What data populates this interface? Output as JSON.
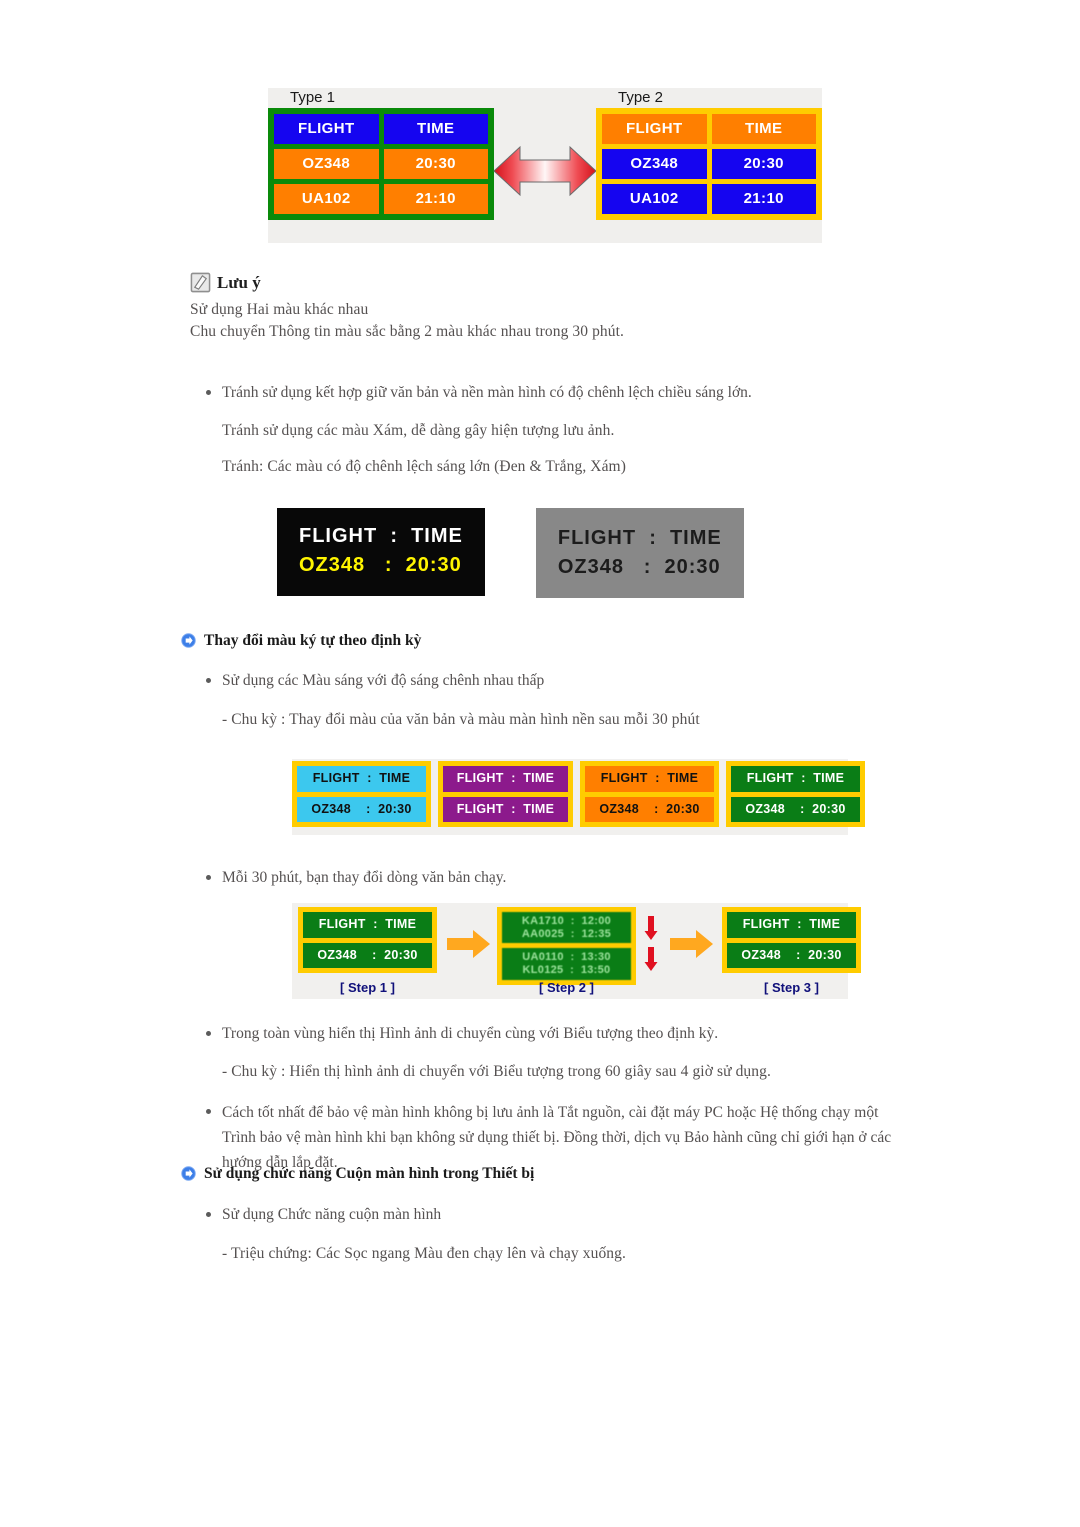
{
  "figure_types": {
    "name": "flight-board-color-swap",
    "columns": [
      {
        "label": "Type 1",
        "border_color": "#0a8a0a",
        "header_cell_color": "#1505f0",
        "data_cell_color": "#ff7f00",
        "rows": [
          [
            "FLIGHT",
            "TIME"
          ],
          [
            "OZ348",
            "20:30"
          ],
          [
            "UA102",
            "21:10"
          ]
        ]
      },
      {
        "label": "Type 2",
        "border_color": "#ffcc00",
        "header_cell_color": "#ff7f00",
        "data_cell_color": "#1505f0",
        "rows": [
          [
            "FLIGHT",
            "TIME"
          ],
          [
            "OZ348",
            "20:30"
          ],
          [
            "UA102",
            "21:10"
          ]
        ]
      }
    ],
    "arrow": "double-headed-horizontal-arrow",
    "arrow_color": "#e8232a"
  },
  "note": {
    "icon": "note-pencil-icon",
    "title": "Lưu ý",
    "lines": [
      "Sử dụng Hai màu khác nhau",
      "Chu chuyển Thông tin màu sắc bằng 2 màu khác nhau trong 30 phút."
    ]
  },
  "contrast_section": {
    "bullet": "Tránh sử dụng kết hợp giữ văn bản và nền màn hình có độ chênh lệch chiều sáng lớn.",
    "sub_lines": [
      "Tránh sử dụng các màu Xám, dễ dàng gây hiện tượng lưu ảnh.",
      "Tránh: Các màu có độ chênh lệch sáng lớn (Đen & Trắng, Xám)"
    ],
    "panels": [
      {
        "name": "black-panel",
        "background": "#080808",
        "line1": "FLIGHT  :  TIME",
        "line1_color": "#ffffff",
        "line2": "OZ348   :  20:30",
        "line2_color": "#fff500"
      },
      {
        "name": "gray-panel",
        "background": "#888888",
        "line1": "FLIGHT  :  TIME",
        "line1_color": "#1c1c1c",
        "line2": "OZ348   :  20:30",
        "line2_color": "#1c1c1c"
      }
    ]
  },
  "section_cycle": {
    "icon": "blue-arrow-bullet-icon",
    "heading": "Thay đổi màu ký tự theo định kỳ",
    "bullet": "Sử dụng các Màu sáng với độ sáng chênh nhau thấp",
    "detail": "- Chu kỳ : Thay đổi màu của văn bản và màu màn hình nền sau mỗi 30 phút",
    "panels": [
      {
        "name": "cyan-board",
        "frame": "#ffcc00",
        "fill": "#3cc8ee",
        "text_color": "#111111",
        "line1": "FLIGHT  :  TIME",
        "line2": "OZ348    :  20:30"
      },
      {
        "name": "purple-board",
        "frame": "#ffcc00",
        "fill": "#8c1a8c",
        "text_color": "#ffffff",
        "line1": "FLIGHT  :  TIME",
        "line2": "FLIGHT  :  TIME"
      },
      {
        "name": "orange-board",
        "frame": "#ffcc00",
        "fill": "#ff7f00",
        "text_color": "#111111",
        "line1": "FLIGHT  :  TIME",
        "line2": "OZ348    :  20:30"
      },
      {
        "name": "green-board",
        "frame": "#ffcc00",
        "fill": "#0a7d16",
        "text_color": "#ffffff",
        "line1": "FLIGHT  :  TIME",
        "line2": "OZ348    :  20:30"
      }
    ],
    "scroll_bullet": "Mỗi 30 phút, bạn thay đổi dòng văn bản chạy.",
    "steps": [
      {
        "caption": "[ Step 1 ]",
        "line1": "FLIGHT  :  TIME",
        "line2": "OZ348    :  20:30",
        "blurred": false
      },
      {
        "caption": "[ Step 2 ]",
        "line1": "KA1710  :  12:00\nAA0025  :  12:35",
        "line2": "UA0110  :  13:30\nKL0125  :  13:50",
        "blurred": true
      },
      {
        "caption": "[ Step 3 ]",
        "line1": "FLIGHT  :  TIME",
        "line2": "OZ348    :  20:30",
        "blurred": false
      }
    ],
    "step_arrow_color": "#ffa81f",
    "down_arrow_color": "#e8232a"
  },
  "moving_image_section": {
    "bullet": "Trong toàn vùng hiển thị Hình ảnh di chuyển cùng với Biểu tượng theo định kỳ.",
    "detail": "- Chu kỳ : Hiển thị hình ảnh di chuyển với Biểu tượng trong 60 giây sau 4 giờ sử dụng.",
    "best_practice": "Cách tốt nhất để bảo vệ màn hình không bị lưu ảnh là Tắt nguồn, cài đặt máy PC hoặc Hệ thống chạy một Trình bảo vệ màn hình khi bạn không sử dụng thiết bị. Đồng thời, dịch vụ Bảo hành cũng chỉ giới hạn ở các hướng dẫn lắp đặt."
  },
  "section_scroll": {
    "icon": "blue-arrow-bullet-icon",
    "heading": "Sử dụng chức năng Cuộn màn hình trong Thiết bị",
    "bullet": "Sử dụng Chức năng cuộn màn hình",
    "detail": "- Triệu chứng: Các Sọc ngang Màu đen chạy lên và chạy xuống."
  }
}
